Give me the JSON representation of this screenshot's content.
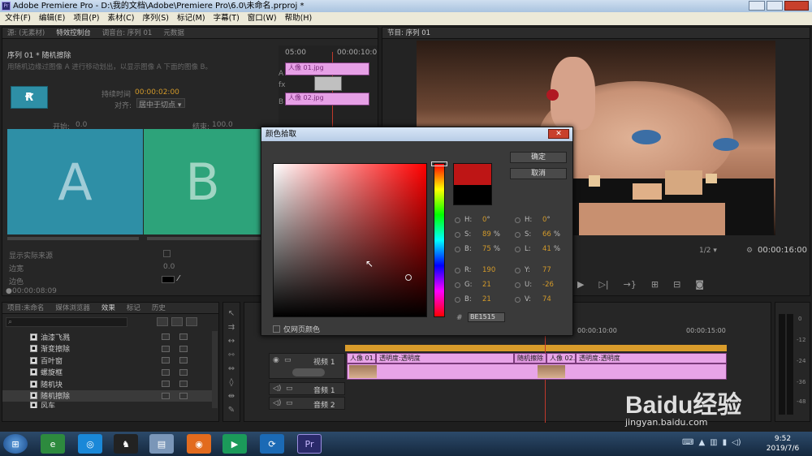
{
  "window": {
    "title": "Adobe Premiere Pro - D:\\我的文档\\Adobe\\Premiere Pro\\6.0\\未命名.prproj *"
  },
  "menu": [
    "文件(F)",
    "编辑(E)",
    "项目(P)",
    "素材(C)",
    "序列(S)",
    "标记(M)",
    "字幕(T)",
    "窗口(W)",
    "帮助(H)"
  ],
  "source_panel": {
    "tabs": [
      "源: (无素材)",
      "特效控制台",
      "调音台: 序列 01",
      "元数据"
    ],
    "sequence_label": "序列 01 * 随机擦除",
    "description": "用随机边缘过图像 A 进行移动划出，以显示图像 A 下面的图像 B。",
    "duration_label": "持续时间",
    "duration_value": "00:00:02:00",
    "align_label": "对齐:",
    "align_value": "居中于切点",
    "start_label": "开始:",
    "start_value": "0.0",
    "end_label": "结束:",
    "end_value": "100.0",
    "a_label": "A",
    "b_label": "B",
    "show_source_label": "显示实际来源",
    "border_width_label": "边宽",
    "border_width_value": "0.0",
    "border_color_label": "边色",
    "timecode": "00:00:08:09",
    "mini_timeline": {
      "time_left": "05:00",
      "time_right": "00:00:10:0",
      "track_a": "A",
      "track_fx": "fx",
      "track_b": "B",
      "clip_a": "人像 01.jpg",
      "clip_b": "人像 02.jpg"
    }
  },
  "program_monitor": {
    "tab": "节目: 序列 01",
    "zoom": "1/2",
    "timecode": "00:00:16:00"
  },
  "color_dialog": {
    "title": "颜色拾取",
    "ok": "确定",
    "cancel": "取消",
    "hsb": {
      "h": "0",
      "s": "89",
      "b": "75"
    },
    "hsl": {
      "h": "0",
      "s": "66",
      "l": "41"
    },
    "rgb": {
      "r": "190",
      "g": "21",
      "b": "21"
    },
    "yuv": {
      "y": "77",
      "u": "-26",
      "v": "74"
    },
    "hex": "BE1515",
    "web_only": "仅网页颜色",
    "degree": "°",
    "percent": "%",
    "hash": "#",
    "labels": {
      "h": "H:",
      "s": "S:",
      "b": "B:",
      "l": "L:",
      "r": "R:",
      "g": "G:",
      "bb": "B:",
      "y": "Y:",
      "u": "U:",
      "v": "V:"
    },
    "new_color": "#be1515",
    "old_color": "#000000"
  },
  "effects_panel": {
    "tabs": [
      "项目:未命名",
      "媒体浏览器",
      "效果",
      "标记",
      "历史"
    ],
    "items": [
      "油漆飞溅",
      "渐变擦除",
      "百叶窗",
      "螺旋框",
      "随机块",
      "随机擦除",
      "风车"
    ]
  },
  "timeline": {
    "ruler": [
      "00:00:10:00",
      "00:00:15:00"
    ],
    "video1": "视频 1",
    "audio1": "音频 1",
    "audio2": "音频 2",
    "clip1": "人像 01.jpg",
    "clip1_fx": "透明度:透明度",
    "transition": "随机擦除",
    "clip2": "人像 02.jpg",
    "clip2_fx": "透明度:透明度"
  },
  "meter_scale": [
    "0",
    "-12",
    "-24",
    "-36",
    "-48"
  ],
  "taskbar": {
    "time": "9:52",
    "date": "2019/7/6",
    "pr_label": "Pr"
  },
  "watermark": {
    "brand": "Baidu经验",
    "url": "jingyan.baidu.com"
  }
}
